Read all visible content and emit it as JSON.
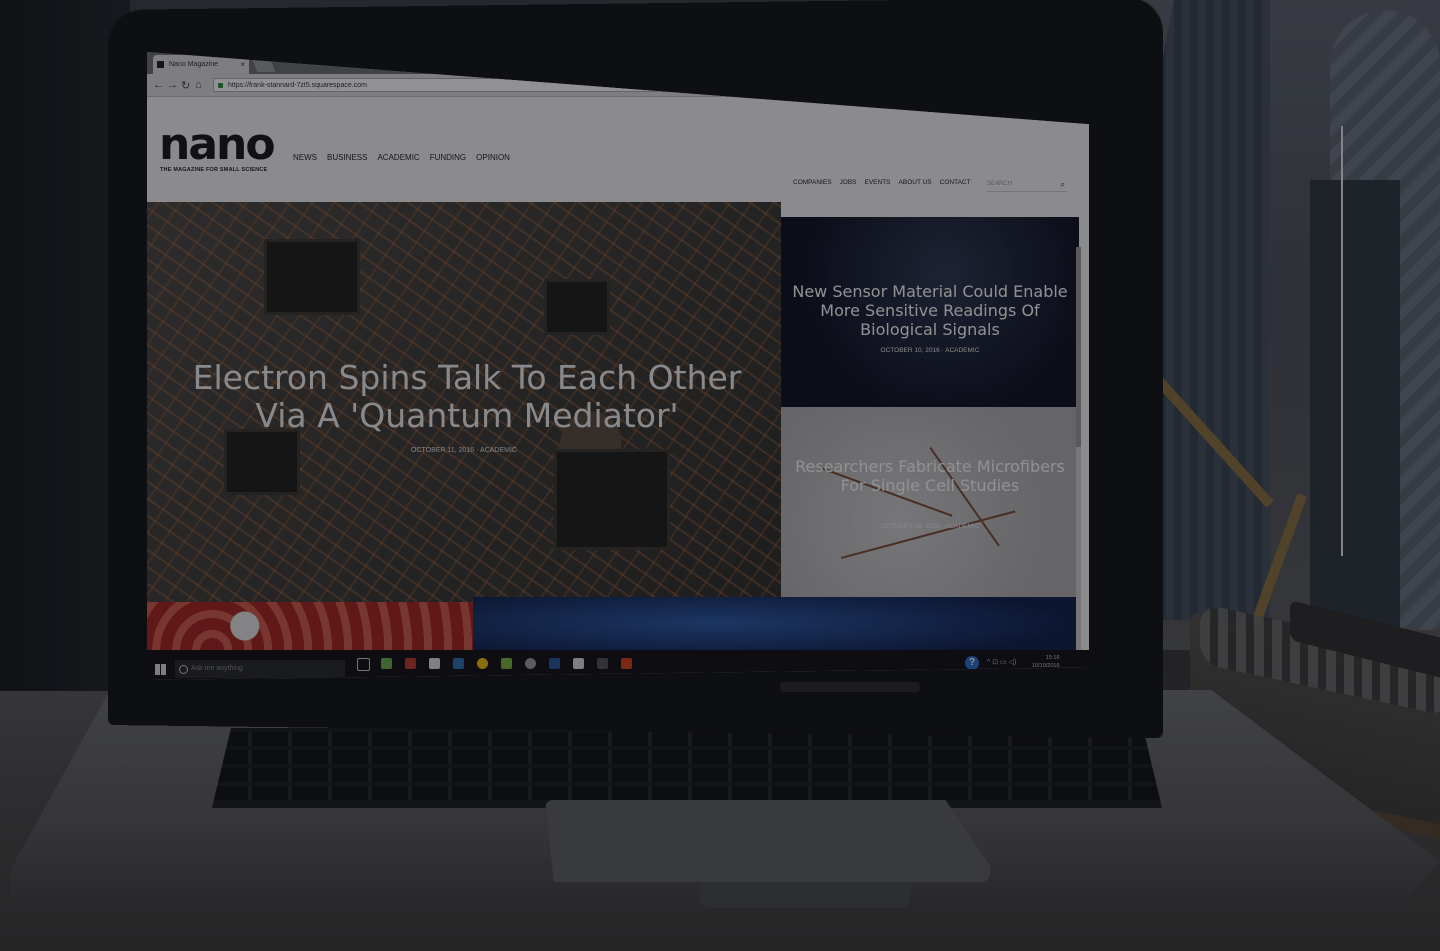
{
  "browser": {
    "tab_title": "Nano Magazine",
    "tab_close": "×",
    "url": "https://frank-stannard-7zt5.squarespace.com",
    "nav": {
      "back": "←",
      "forward": "→",
      "reload": "↻",
      "home": "⌂"
    },
    "window": {
      "minimize": "–",
      "maximize": "▫",
      "close": "✕"
    }
  },
  "site": {
    "logo": "nano",
    "tagline": "THE MAGAZINE FOR SMALL SCIENCE",
    "main_nav": [
      "NEWS",
      "BUSINESS",
      "ACADEMIC",
      "FUNDING",
      "OPINION"
    ],
    "secondary_nav": [
      "COMPANIES",
      "JOBS",
      "EVENTS",
      "ABOUT US",
      "CONTACT"
    ],
    "search_placeholder": "SEARCH",
    "search_icon": "⌕",
    "hero": {
      "title": "Electron Spins Talk To Each Other Via A 'Quantum Mediator'",
      "date": "OCTOBER 11, 2016",
      "category": "ACADEMIC"
    },
    "articles": [
      {
        "title": "New Sensor Material Could Enable More Sensitive Readings Of Biological Signals",
        "date": "OCTOBER 10, 2016",
        "category": "ACADEMIC"
      },
      {
        "title": "Researchers Fabricate Microfibers For Single Cell Studies",
        "date": "OCTOBER 06, 2016",
        "category": "ACADEMIC"
      }
    ],
    "meta_separator": "·"
  },
  "taskbar": {
    "search_placeholder": "Ask me anything",
    "help": "?",
    "time": "15:16",
    "date": "10/10/2016",
    "tray": "^ ⊡ ▭ ◁)"
  },
  "colors": {
    "overlay": "#0a0c10",
    "close_button": "#d0322e",
    "help_blue": "#2d6fd0"
  }
}
